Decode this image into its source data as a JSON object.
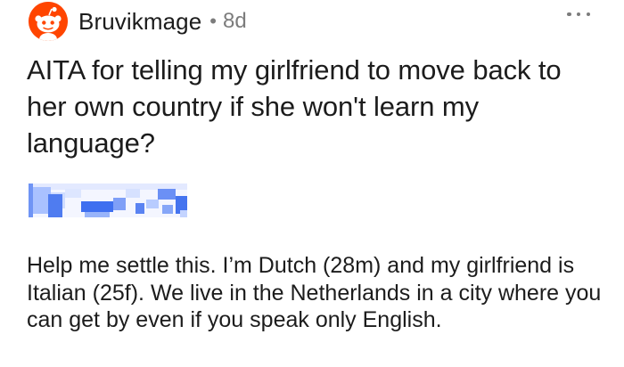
{
  "post": {
    "author": "Bruvikmage",
    "separator": "•",
    "age": "8d",
    "title": "AITA for telling my girlfriend to move back to her own country if she won't learn my language?",
    "body": "Help me settle this. I’m Dutch (28m) and my girlfriend is Italian (25f). We live in the Netherlands in a city where you can get by even if you speak only English."
  },
  "icons": {
    "avatar": "snoo-avatar-icon",
    "more": "more-options-icon",
    "flair": "redacted-flair"
  },
  "colors": {
    "avatar_background": "#ff4500",
    "text": "#1c1c1c",
    "meta": "#7c7c7c",
    "flair": "#2f6ff0"
  }
}
